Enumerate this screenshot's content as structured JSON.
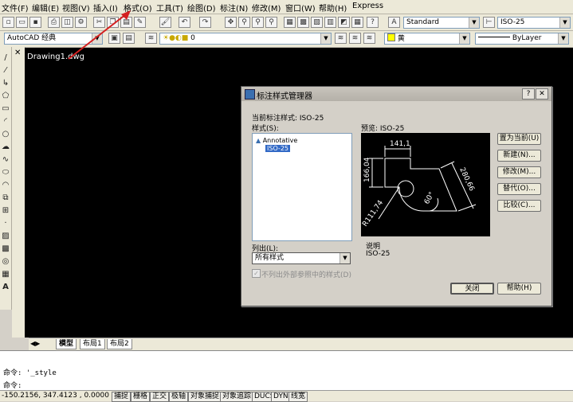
{
  "menu": [
    "文件(F)",
    "编辑(E)",
    "视图(V)",
    "插入(I)",
    "格式(O)",
    "工具(T)",
    "绘图(D)",
    "标注(N)",
    "修改(M)",
    "窗口(W)",
    "帮助(H)",
    "Express"
  ],
  "toolbar": {
    "text_style": "Standard",
    "dim_style": "ISO-25",
    "workspace": "AutoCAD 经典",
    "layer": "0",
    "color": "黄",
    "linetype": "ByLayer",
    "icons": [
      "new-icon",
      "open-icon",
      "save-icon",
      "print-icon",
      "preview-icon",
      "publish-icon",
      "cut-icon",
      "copy-icon",
      "paste-icon",
      "matchprop-icon",
      "undo-icon",
      "redo-icon",
      "pan-icon",
      "zoom-icon",
      "zoom-window-icon",
      "zoom-previous-icon",
      "properties-icon",
      "designcenter-icon",
      "toolpalettes-icon",
      "sheetset-icon",
      "markup-icon",
      "calculator-icon",
      "help-icon"
    ]
  },
  "document": {
    "tab": "Drawing1.dwg"
  },
  "layout_tabs": [
    "模型",
    "布局1",
    "布局2"
  ],
  "command": {
    "line1": "命令: '_style",
    "line2": "命令:"
  },
  "status": {
    "coords": "-150.2156, 347.4123 , 0.0000",
    "toggles": [
      "捕捉",
      "栅格",
      "正交",
      "极轴",
      "对象捕捉",
      "对象追踪",
      "DUCS",
      "DYN",
      "线宽"
    ]
  },
  "dialog": {
    "title": "标注样式管理器",
    "current_style_label": "当前标注样式: ISO-25",
    "styles_label": "样式(S):",
    "styles": [
      "Annotative",
      "ISO-25"
    ],
    "selected_style": "ISO-25",
    "preview_label": "预览: ISO-25",
    "list_label": "列出(L):",
    "list_value": "所有样式",
    "checkbox_label": "不列出外部参照中的样式(D)",
    "desc_label": "说明",
    "desc_value": "ISO-25",
    "buttons": {
      "set_current": "置为当前(U)",
      "new": "新建(N)...",
      "modify": "修改(M)...",
      "override": "替代(O)...",
      "compare": "比较(C)...",
      "close": "关闭",
      "help": "帮助(H)"
    },
    "preview_dims": {
      "d1": "141,1",
      "d2": "166,04",
      "d3": "280,66",
      "d4": "60°",
      "d5": "R111,74"
    }
  },
  "colors": {
    "drawing_bg": "#000000",
    "selection": "#3169c6",
    "arrow": "#d42020"
  }
}
